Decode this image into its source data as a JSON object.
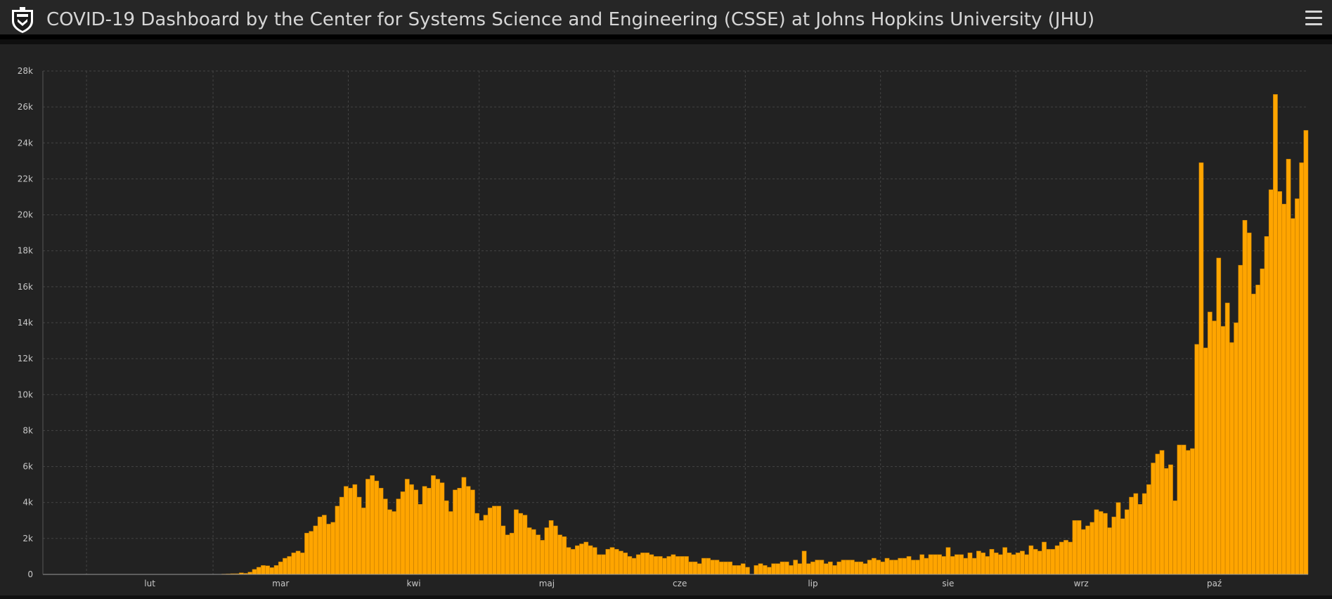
{
  "header": {
    "title": "COVID-19 Dashboard by the Center for Systems Science and Engineering (CSSE) at Johns Hopkins University (JHU)",
    "logo_icon": "jhu-shield-icon",
    "menu_icon": "hamburger-menu-icon"
  },
  "colors": {
    "header_bg": "#262626",
    "panel_bg": "#222222",
    "bar": "#ffa500",
    "bar_edge": "#b87400",
    "grid": "#444444",
    "tick_text": "#c8c8c8",
    "title_text": "#d6d6d6"
  },
  "chart_data": {
    "type": "bar",
    "title": "",
    "xlabel": "",
    "ylabel": "",
    "x_start": "2020-01-22",
    "x_tick_labels": [
      {
        "label": "lut",
        "date": "2020-02-01"
      },
      {
        "label": "mar",
        "date": "2020-03-01"
      },
      {
        "label": "kwi",
        "date": "2020-04-01"
      },
      {
        "label": "maj",
        "date": "2020-05-01"
      },
      {
        "label": "cze",
        "date": "2020-06-01"
      },
      {
        "label": "lip",
        "date": "2020-07-01"
      },
      {
        "label": "sie",
        "date": "2020-08-01"
      },
      {
        "label": "wrz",
        "date": "2020-09-01"
      },
      {
        "label": "paź",
        "date": "2020-10-01"
      }
    ],
    "y_ticks": [
      "0",
      "2k",
      "4k",
      "6k",
      "8k",
      "10k",
      "12k",
      "14k",
      "16k",
      "18k",
      "20k",
      "22k",
      "24k",
      "26k",
      "28k"
    ],
    "ylim": [
      0,
      28000
    ],
    "grid": true,
    "series": [
      {
        "values": [
          0,
          0,
          0,
          0,
          0,
          0,
          0,
          0,
          0,
          0,
          0,
          0,
          0,
          0,
          0,
          0,
          0,
          0,
          0,
          0,
          0,
          0,
          0,
          0,
          0,
          0,
          0,
          0,
          0,
          0,
          0,
          0,
          0,
          0,
          0,
          0,
          0,
          0,
          0,
          0,
          0,
          20,
          30,
          40,
          40,
          90,
          60,
          130,
          280,
          400,
          500,
          480,
          380,
          500,
          700,
          900,
          1000,
          1200,
          1300,
          1200,
          2300,
          2400,
          2700,
          3200,
          3300,
          2800,
          2900,
          3800,
          4300,
          4900,
          4800,
          5000,
          4300,
          3700,
          5300,
          5500,
          5200,
          4800,
          4200,
          3600,
          3500,
          4200,
          4600,
          5300,
          5000,
          4700,
          3900,
          4900,
          4800,
          5500,
          5300,
          5100,
          4100,
          3500,
          4700,
          4800,
          5400,
          4900,
          4700,
          3400,
          3000,
          3300,
          3700,
          3800,
          3800,
          2700,
          2200,
          2300,
          3600,
          3400,
          3300,
          2600,
          2500,
          2200,
          1900,
          2600,
          3000,
          2700,
          2200,
          2100,
          1500,
          1400,
          1600,
          1700,
          1800,
          1600,
          1500,
          1100,
          1100,
          1400,
          1500,
          1400,
          1300,
          1200,
          1000,
          900,
          1100,
          1200,
          1200,
          1100,
          1000,
          1000,
          900,
          1000,
          1100,
          1000,
          1000,
          1000,
          700,
          700,
          600,
          900,
          900,
          800,
          800,
          700,
          700,
          700,
          500,
          500,
          600,
          400,
          0,
          500,
          600,
          500,
          400,
          600,
          600,
          700,
          700,
          500,
          800,
          600,
          1300,
          600,
          700,
          800,
          800,
          600,
          700,
          500,
          700,
          800,
          800,
          800,
          700,
          700,
          600,
          800,
          900,
          800,
          700,
          900,
          800,
          800,
          900,
          900,
          1000,
          800,
          800,
          1100,
          900,
          1100,
          1100,
          1100,
          1000,
          1500,
          1000,
          1100,
          1100,
          900,
          1200,
          900,
          1300,
          1200,
          1000,
          1400,
          1200,
          1100,
          1500,
          1200,
          1100,
          1200,
          1300,
          1100,
          1600,
          1400,
          1300,
          1800,
          1400,
          1400,
          1600,
          1800,
          1900,
          1800,
          3000,
          3000,
          2500,
          2700,
          2900,
          3600,
          3500,
          3400,
          2600,
          3200,
          4000,
          3100,
          3600,
          4300,
          4500,
          3900,
          4500,
          5000,
          6200,
          6700,
          6900,
          5900,
          6100,
          4100,
          7200,
          7200,
          6900,
          7000,
          12800,
          22900,
          12600,
          14600,
          14100,
          17600,
          13800,
          15100,
          12900,
          14000,
          17200,
          19700,
          19000,
          15600,
          16100,
          17000,
          18800,
          21400,
          26700,
          21300,
          20600,
          23100,
          19800,
          20900,
          22900,
          24700
        ]
      }
    ]
  }
}
